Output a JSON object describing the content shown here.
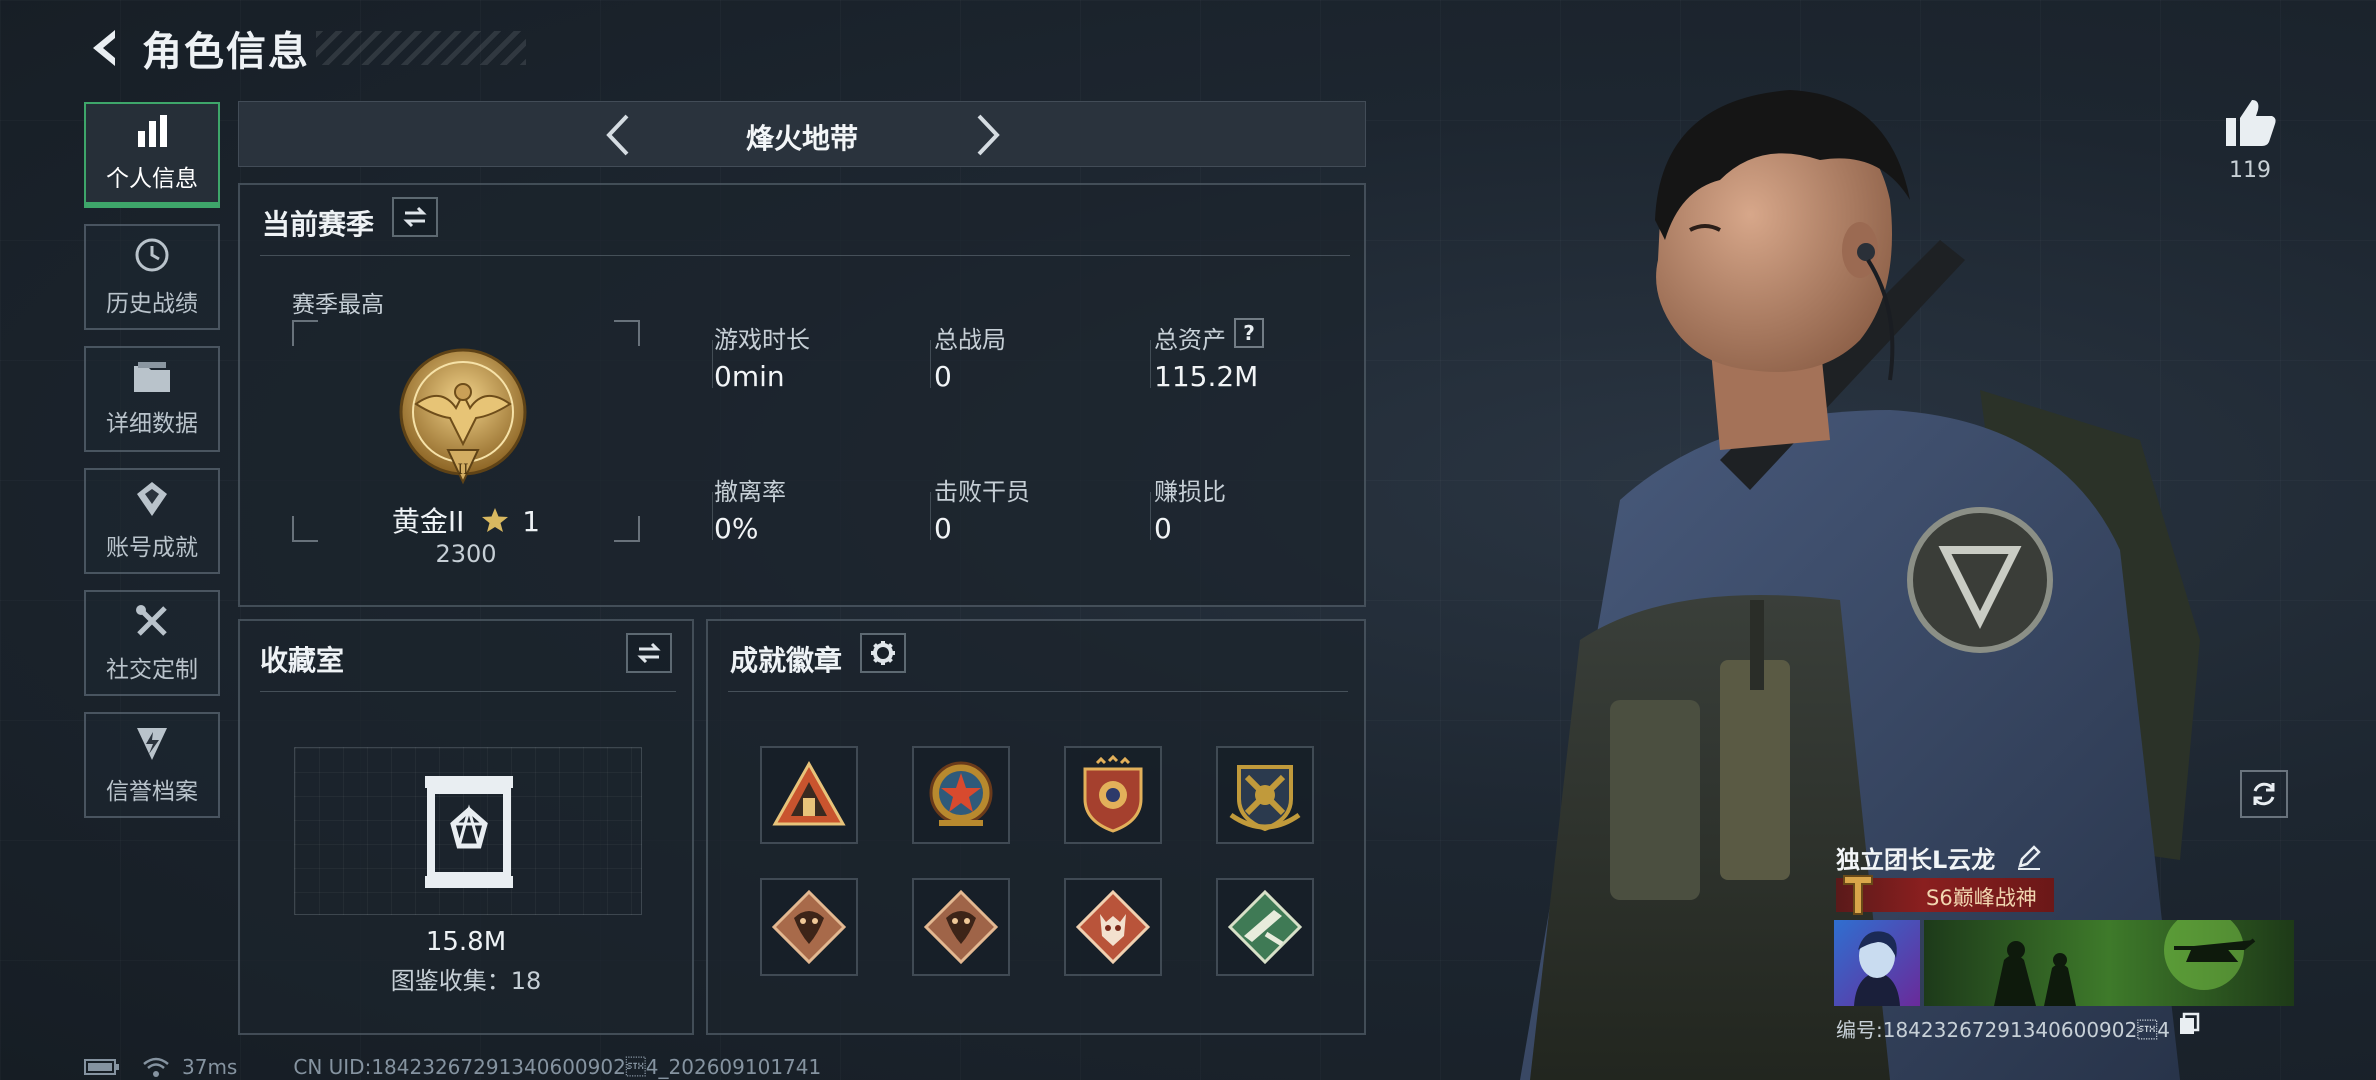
{
  "header": {
    "title": "角色信息"
  },
  "sidebar": {
    "items": [
      {
        "label": "个人信息",
        "icon": "bar-chart-icon",
        "active": true
      },
      {
        "label": "历史战绩",
        "icon": "history-clock-icon"
      },
      {
        "label": "详细数据",
        "icon": "folder-icon"
      },
      {
        "label": "账号成就",
        "icon": "achievement-icon"
      },
      {
        "label": "社交定制",
        "icon": "tools-icon"
      },
      {
        "label": "信誉档案",
        "icon": "credit-shield-icon"
      }
    ]
  },
  "mode": {
    "name": "烽火地带"
  },
  "season": {
    "title": "当前赛季",
    "best_label": "赛季最高",
    "rank_name": "黄金II",
    "rank_stars": "1",
    "rank_score": "2300",
    "stats": [
      {
        "label": "游戏时长",
        "value": "0min"
      },
      {
        "label": "总战局",
        "value": "0"
      },
      {
        "label": "总资产",
        "value": "115.2M",
        "help": "?"
      },
      {
        "label": "撤离率",
        "value": "0%"
      },
      {
        "label": "击败干员",
        "value": "0"
      },
      {
        "label": "赚损比",
        "value": "0"
      }
    ]
  },
  "collection": {
    "title": "收藏室",
    "value": "15.8M",
    "count_text": "图鉴收集：18"
  },
  "achievements": {
    "title": "成就徽章",
    "badges": [
      {
        "icon": "pyramid-badge-icon",
        "color": "#c9542e"
      },
      {
        "icon": "star-compass-badge-icon",
        "color": "#b8892e"
      },
      {
        "icon": "shield-stars-badge-icon",
        "color": "#a5402e"
      },
      {
        "icon": "crossed-arms-badge-icon",
        "color": "#c19a3b"
      },
      {
        "icon": "dragon-badge-icon",
        "color": "#a86a4a"
      },
      {
        "icon": "dragon-badge-icon-2",
        "color": "#9f6448"
      },
      {
        "icon": "beast-badge-icon",
        "color": "#b9543a"
      },
      {
        "icon": "rifle-badge-icon",
        "color": "#3f7a55"
      }
    ]
  },
  "profile": {
    "likes": "119",
    "nickname": "独立团长L云龙",
    "title_badge": "S6巅峰战神",
    "id_text": "编号:18423267291340600902\u00024"
  },
  "status": {
    "ping": "37ms",
    "uid_text": "CN UID:18423267291340600902\u00024_202609101741"
  },
  "colors": {
    "accent_green": "#3ea66a",
    "gold": "#c9a44a",
    "title_red": "#8a1f1f"
  }
}
